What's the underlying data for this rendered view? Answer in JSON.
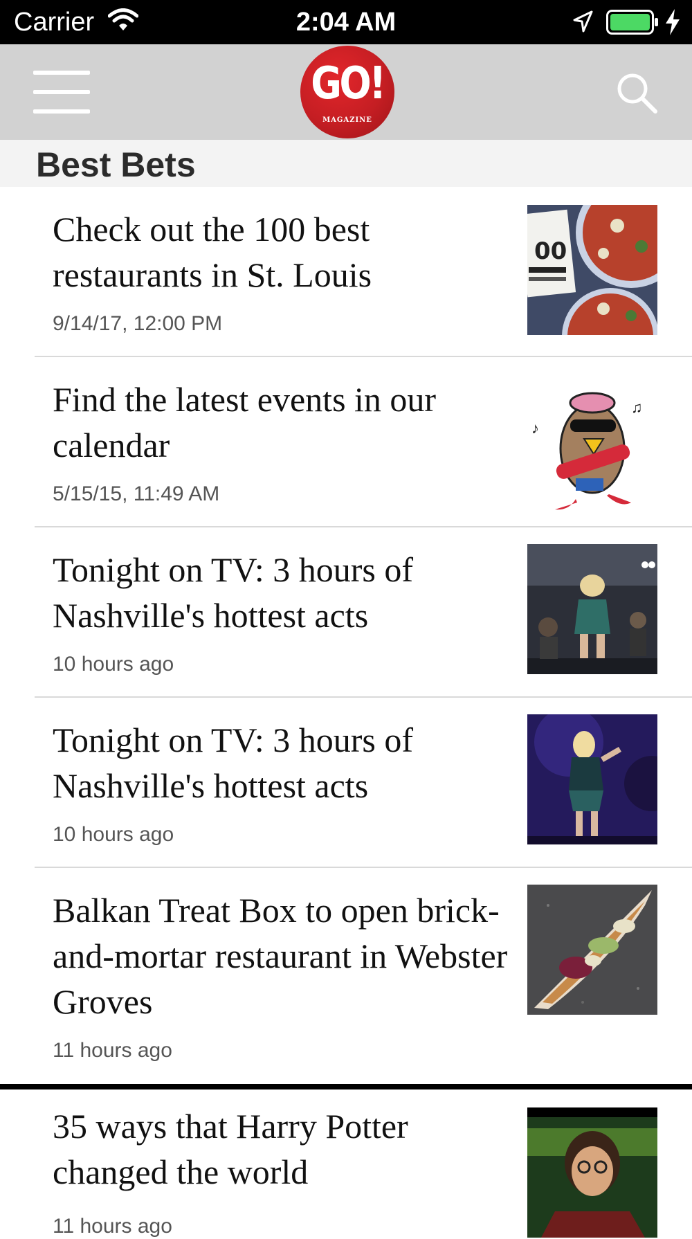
{
  "status_bar": {
    "carrier": "Carrier",
    "time": "2:04 AM",
    "icons": [
      "wifi-icon",
      "location-arrow-icon",
      "battery-icon",
      "charging-bolt-icon"
    ],
    "battery_color": "#4cd964"
  },
  "nav": {
    "logo_text": "GO!",
    "logo_subtext": "MAGAZINE",
    "logo_color": "#c51e23",
    "background": "#d2d2d2",
    "icons": [
      "hamburger-menu-icon",
      "search-icon"
    ]
  },
  "section": {
    "title": "Best Bets"
  },
  "articles": [
    {
      "title": "Check out the 100 best restaurants in St. Louis",
      "date": "9/14/17, 12:00 PM",
      "thumbnail": "pizza-image"
    },
    {
      "title": "Find the latest events in our calendar",
      "date": "5/15/15, 11:49 AM",
      "thumbnail": "cartoon-guitar-mascot-image"
    },
    {
      "title": "Tonight on TV: 3 hours of Nashville's hottest acts",
      "date": "10 hours ago",
      "thumbnail": "concert-stage-image"
    },
    {
      "title": "Tonight on TV: 3 hours of Nashville's hottest acts",
      "date": "10 hours ago",
      "thumbnail": "performer-purple-stage-image"
    },
    {
      "title": "Balkan Treat Box to open brick-and-mortar restaurant in Webster Groves",
      "date": "11 hours ago",
      "thumbnail": "flatbread-food-image"
    },
    {
      "title": "35 ways that Harry Potter changed the world",
      "date": "11 hours ago",
      "thumbnail": "harry-potter-image"
    }
  ]
}
